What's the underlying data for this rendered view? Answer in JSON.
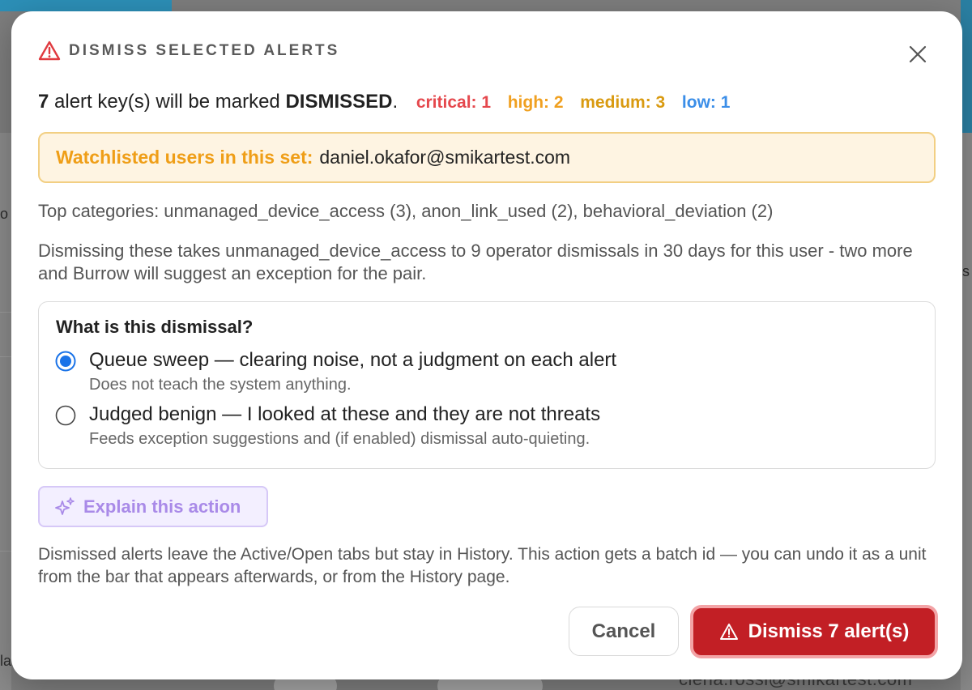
{
  "background": {
    "left_fragment_1": "o",
    "left_fragment_2": "la",
    "right_fragment": "s",
    "bottom_text": "ciena.rossi@smikartest.com"
  },
  "modal": {
    "header": {
      "icon": "warning-triangle-icon",
      "title": "DISMISS SELECTED ALERTS",
      "close_icon": "close-icon"
    },
    "summary": {
      "count": "7",
      "text_before": "alert key(s) will be marked",
      "status": "DISMISSED",
      "period": ".",
      "severities": {
        "critical": "critical: 1",
        "high": "high: 2",
        "medium": "medium: 3",
        "low": "low: 1"
      }
    },
    "watchlist": {
      "label": "Watchlisted users in this set:",
      "value": "daniel.okafor@smikartest.com"
    },
    "top_categories": "Top categories: unmanaged_device_access (3), anon_link_used (2), behavioral_deviation (2)",
    "impact_note": "Dismissing these takes unmanaged_device_access to 9 operator dismissals in 30 days for this user - two more and Burrow will suggest an exception for the pair.",
    "dismissal_type": {
      "question": "What is this dismissal?",
      "options": [
        {
          "label": "Queue sweep — clearing noise, not a judgment on each alert",
          "description": "Does not teach the system anything.",
          "selected": true
        },
        {
          "label": "Judged benign — I looked at these and they are not threats",
          "description": "Feeds exception suggestions and (if enabled) dismissal auto-quieting.",
          "selected": false
        }
      ]
    },
    "explain_button": {
      "icon": "sparkles-icon",
      "label": "Explain this action"
    },
    "footer_note": "Dismissed alerts leave the Active/Open tabs but stay in History. This action gets a batch id — you can undo it as a unit from the bar that appears afterwards, or from the History page.",
    "cancel_label": "Cancel",
    "dismiss_button": {
      "icon": "warning-triangle-icon",
      "label": "Dismiss 7 alert(s)"
    }
  },
  "colors": {
    "accent_radio": "#1a73e8",
    "danger": "#c21f25",
    "critical": "#e5484d",
    "high": "#f0a020",
    "medium": "#d99a10",
    "low": "#3b8ee8",
    "watch_label": "#ef9e17",
    "explain": "#a98ae8"
  }
}
